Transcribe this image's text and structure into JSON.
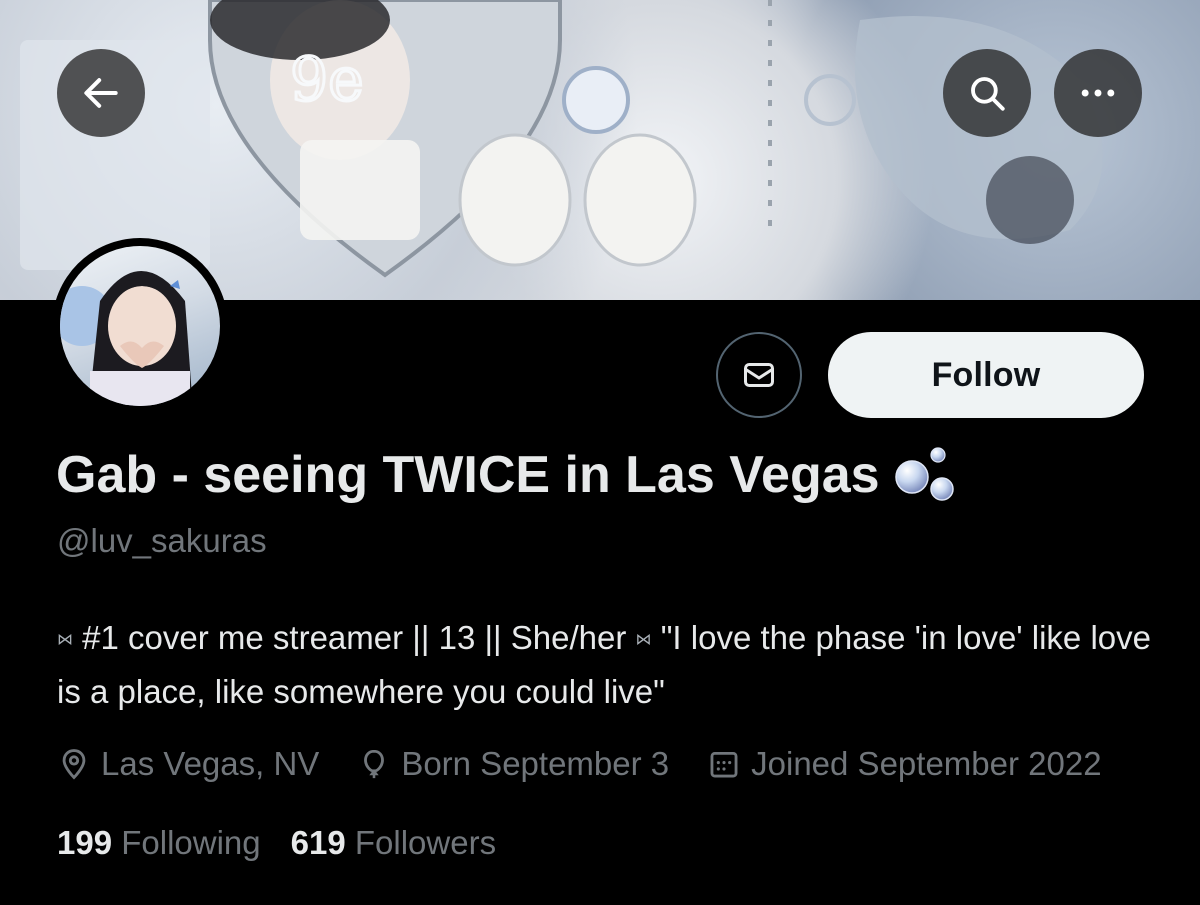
{
  "header": {
    "back_icon": "arrow-left-icon",
    "search_icon": "search-icon",
    "more_icon": "more-horizontal-icon"
  },
  "profile": {
    "display_name": "Gab - seeing TWICE in Las Vegas",
    "name_emoji_icon": "bubbles-icon",
    "handle": "@luv_sakuras",
    "bio_glyph": "⋈",
    "bio_part1": "#1 cover me streamer || 13 || She/her",
    "bio_part2": "\"I love the phase 'in love' like love is a place, like somewhere you could live\"",
    "location": "Las Vegas, NV",
    "birthday": "Born September 3",
    "joined": "Joined September 2022",
    "following_count": "199",
    "following_label": "Following",
    "followers_count": "619",
    "followers_label": "Followers"
  },
  "actions": {
    "message_icon": "envelope-icon",
    "follow_label": "Follow"
  },
  "colors": {
    "background": "#000000",
    "primary_text": "#e7e9ea",
    "secondary_text": "#71767b",
    "follow_bg": "#eff3f4"
  }
}
